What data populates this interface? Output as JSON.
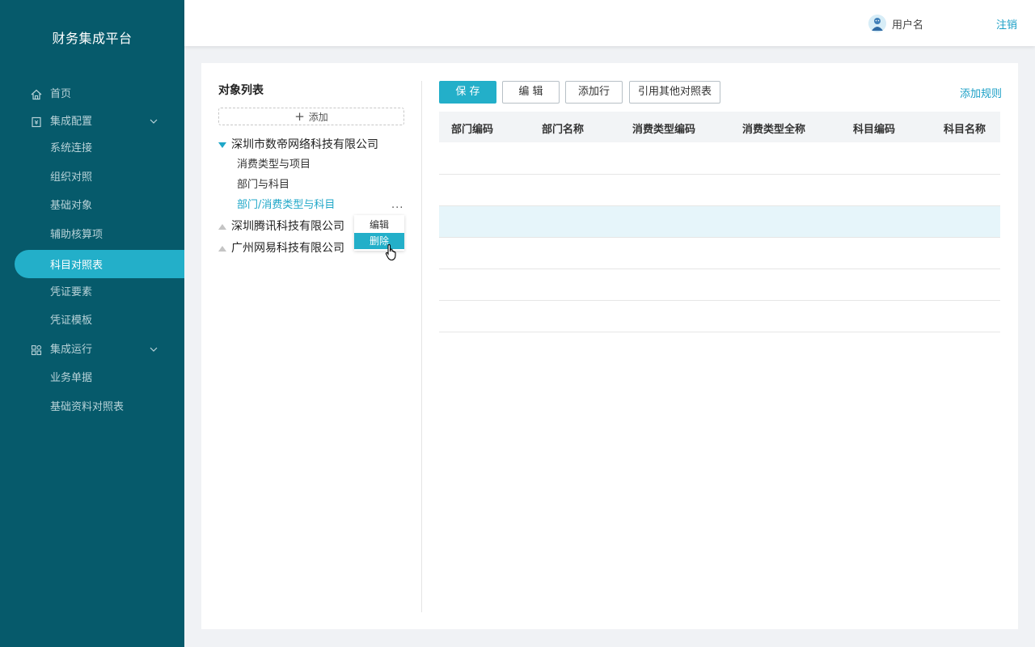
{
  "brand": "财务集成平台",
  "nav": {
    "home": "首页",
    "integration_config": {
      "label": "集成配置",
      "children": [
        "系统连接",
        "组织对照",
        "基础对象",
        "辅助核算项",
        "科目对照表",
        "凭证要素",
        "凭证模板"
      ],
      "active": "科目对照表"
    },
    "integration_run": {
      "label": "集成运行",
      "children": [
        "业务单据",
        "基础资料对照表"
      ]
    }
  },
  "header": {
    "username": "用户名",
    "logout": "注销"
  },
  "object_list": {
    "title": "对象列表",
    "add_label": "添加",
    "tree": [
      {
        "label": "深圳市数帝网络科技有限公司",
        "expanded": true,
        "children": [
          "消费类型与项目",
          "部门与科目",
          "部门/消费类型与科目"
        ]
      },
      {
        "label": "深圳腾讯科技有限公司",
        "expanded": false
      },
      {
        "label": "广州网易科技有限公司",
        "expanded": false
      }
    ],
    "more": "...",
    "context_menu": [
      "编辑",
      "删除"
    ]
  },
  "toolbar": {
    "save": "保 存",
    "edit": "编 辑",
    "add_row": "添加行",
    "reference": "引用其他对照表",
    "add_rule": "添加规则"
  },
  "table": {
    "columns": [
      "部门编码",
      "部门名称",
      "消费类型编码",
      "消费类型全称",
      "科目编码",
      "科目名称"
    ],
    "rows": 6,
    "selected_row": 3
  },
  "colors": {
    "sidebar_bg": "#065a6b",
    "accent": "#23afc9",
    "link": "#1a9fc6"
  }
}
